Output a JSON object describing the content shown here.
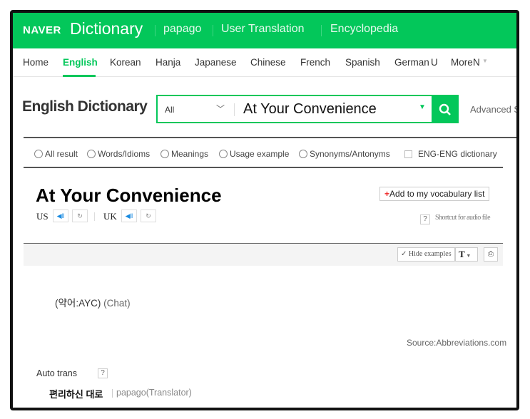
{
  "header": {
    "logo": "NAVER",
    "title": "Dictionary",
    "links": [
      "papago",
      "User Translation",
      "Encyclopedia"
    ]
  },
  "nav": {
    "items": [
      "Home",
      "English",
      "Korean",
      "Hanja",
      "Japanese",
      "Chinese",
      "French",
      "Spanish",
      "German",
      "More"
    ],
    "active": "English",
    "german_badge": "U",
    "more_badge": "N"
  },
  "search": {
    "page_title": "English Dictionary",
    "scope": "All",
    "query": "At Your Convenience",
    "advanced": "Advanced Search"
  },
  "filters": {
    "options": [
      "All result",
      "Words/Idioms",
      "Meanings",
      "Usage example",
      "Synonyms/Antonyms"
    ],
    "checkbox": "ENG-ENG dictionary"
  },
  "entry": {
    "word": "At Your Convenience",
    "us_label": "US",
    "uk_label": "UK",
    "add_vocab": "Add to my vocabulary list",
    "shortcut": "Shortcut for audio file",
    "help": "?",
    "toolbar": {
      "hide_examples": "Hide examples",
      "font": "T"
    },
    "definition_abbr": "(약어:AYC)",
    "definition_tag": "(Chat)",
    "source": "Source:Abbreviations.com"
  },
  "auto_trans": {
    "label": "Auto trans",
    "help": "?",
    "translation": "편리하신 대로",
    "provider": "papago(Translator)"
  },
  "colors": {
    "brand": "#03c75a",
    "badge": "#ff3333"
  }
}
